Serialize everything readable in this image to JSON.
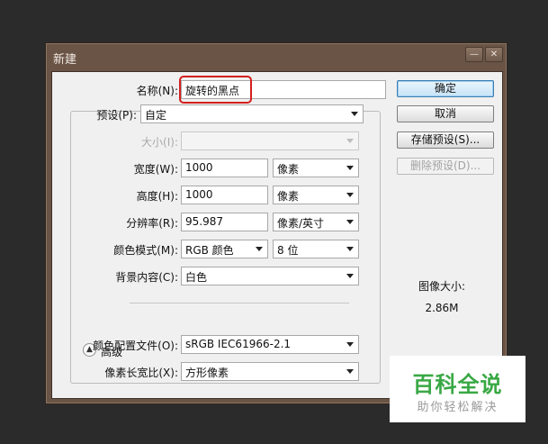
{
  "window": {
    "title": "新建",
    "minimize_glyph": "—",
    "close_glyph": "✕"
  },
  "form": {
    "name_label": "名称(N):",
    "name_value": "旋转的黑点",
    "preset_label": "预设(P):",
    "preset_value": "自定",
    "size_label": "大小(I):",
    "size_value": "",
    "width_label": "宽度(W):",
    "width_value": "1000",
    "width_unit": "像素",
    "height_label": "高度(H):",
    "height_value": "1000",
    "height_unit": "像素",
    "resolution_label": "分辨率(R):",
    "resolution_value": "95.987",
    "resolution_unit": "像素/英寸",
    "color_mode_label": "颜色模式(M):",
    "color_mode_value": "RGB 颜色",
    "bit_depth": "8 位",
    "background_label": "背景内容(C):",
    "background_value": "白色",
    "advanced_label": "高级",
    "profile_label": "颜色配置文件(O):",
    "profile_value": "sRGB IEC61966-2.1",
    "aspect_label": "像素长宽比(X):",
    "aspect_value": "方形像素"
  },
  "buttons": {
    "ok": "确定",
    "cancel": "取消",
    "save_preset": "存储预设(S)...",
    "delete_preset": "删除预设(D)..."
  },
  "image_size": {
    "label": "图像大小:",
    "value": "2.86M"
  },
  "watermark": {
    "title": "百科全说",
    "subtitle": "助你轻松解决"
  }
}
